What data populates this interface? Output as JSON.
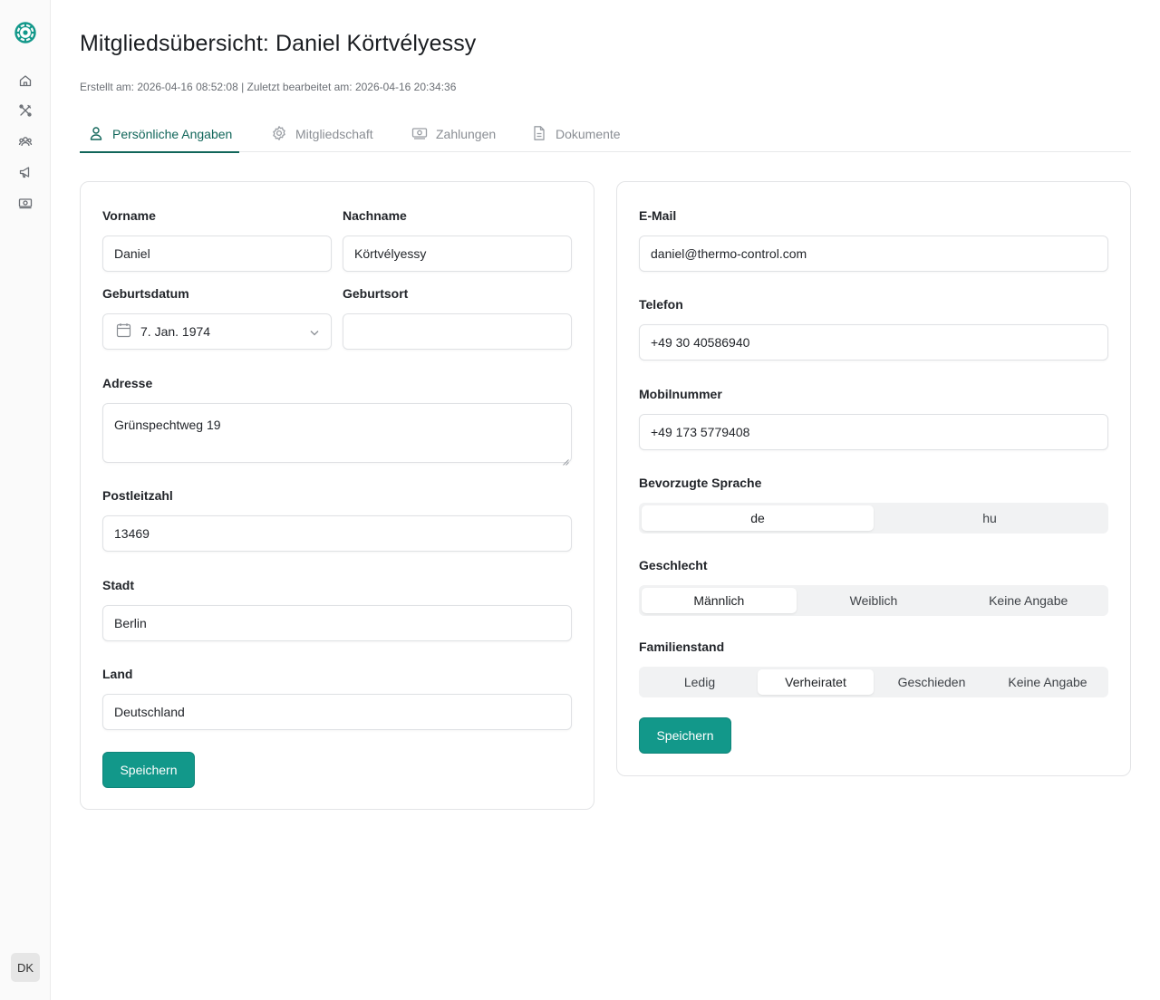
{
  "app": {
    "logo_icon": "dharma-wheel-icon",
    "brand_color": "#12988a",
    "accent_color": "#11665a"
  },
  "sidebar": {
    "items": [
      {
        "icon": "home-icon"
      },
      {
        "icon": "tools-icon"
      },
      {
        "icon": "people-icon"
      },
      {
        "icon": "megaphone-icon"
      },
      {
        "icon": "money-icon"
      }
    ],
    "avatar_initials": "DK"
  },
  "page": {
    "title": "Mitgliedsübersicht: Daniel Körtvélyessy",
    "meta": "Erstellt am: 2026-04-16 08:52:08 | Zuletzt bearbeitet am: 2026-04-16 20:34:36"
  },
  "tabs": [
    {
      "label": "Persönliche Angaben",
      "icon": "user-icon",
      "active": true
    },
    {
      "label": "Mitgliedschaft",
      "icon": "gear-icon",
      "active": false
    },
    {
      "label": "Zahlungen",
      "icon": "money-icon",
      "active": false
    },
    {
      "label": "Dokumente",
      "icon": "document-icon",
      "active": false
    }
  ],
  "personal": {
    "first_name_label": "Vorname",
    "first_name": "Daniel",
    "last_name_label": "Nachname",
    "last_name": "Körtvélyessy",
    "birthdate_label": "Geburtsdatum",
    "birthdate": "7. Jan. 1974",
    "birthplace_label": "Geburtsort",
    "birthplace": "",
    "address_label": "Adresse",
    "address": "Grünspechtweg 19",
    "zip_label": "Postleitzahl",
    "zip": "13469",
    "city_label": "Stadt",
    "city": "Berlin",
    "country_label": "Land",
    "country": "Deutschland",
    "save_label": "Speichern"
  },
  "contact": {
    "email_label": "E-Mail",
    "email": "daniel@thermo-control.com",
    "phone_label": "Telefon",
    "phone": "+49 30 40586940",
    "mobile_label": "Mobilnummer",
    "mobile": "+49 173 5779408",
    "language_label": "Bevorzugte Sprache",
    "language_options": [
      "de",
      "hu"
    ],
    "language_selected": "de",
    "gender_label": "Geschlecht",
    "gender_options": [
      "Männlich",
      "Weiblich",
      "Keine Angabe"
    ],
    "gender_selected": "Männlich",
    "marital_label": "Familienstand",
    "marital_options": [
      "Ledig",
      "Verheiratet",
      "Geschieden",
      "Keine Angabe"
    ],
    "marital_selected": "Verheiratet",
    "save_label": "Speichern"
  }
}
